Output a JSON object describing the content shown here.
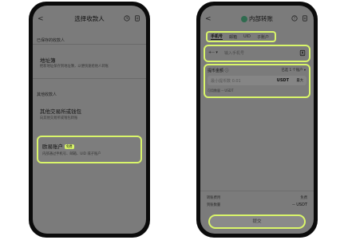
{
  "left_phone": {
    "title": "选择收款人",
    "back": "<",
    "section_saved": "已保存的收款人",
    "address_book_title": "地址簿",
    "address_book_sub": "把新地址保存到地址簿，以便快速给他人转账",
    "section_other": "其他收款人",
    "other_exchange_title": "其他交易所或钱包",
    "other_exchange_sub": "向其他交易所或钱包转账",
    "okx_title": "欧易账户",
    "okx_badge": "免费",
    "okx_sub": "内部通过手机号、邮箱、UID 或子账户"
  },
  "right_phone": {
    "title": "内部转账",
    "back": "<",
    "tabs": [
      "手机号",
      "邮箱",
      "UID",
      "子账户"
    ],
    "country_code": "+--",
    "phone_placeholder": "输入手机号",
    "amount_label": "提币金额",
    "amount_info": "ⓘ",
    "account_select": "已选 1 个账户",
    "amount_placeholder": "最小提币数 0.01",
    "currency": "USDT",
    "max_label": "最大",
    "available": "可用数量 -- USDT",
    "fee_label": "转账费用",
    "fee_value": "免费",
    "receive_label": "到账数量",
    "receive_value": "-- USDT",
    "submit_label": "提交"
  }
}
